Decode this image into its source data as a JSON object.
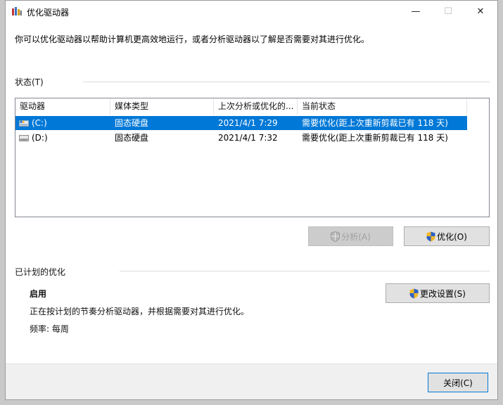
{
  "window": {
    "title": "优化驱动器",
    "controls": {
      "minimize": "—",
      "maximize": "☐",
      "close": "✕"
    }
  },
  "intro_text": "你可以优化驱动器以帮助计算机更高效地运行，或者分析驱动器以了解是否需要对其进行优化。",
  "status": {
    "label": "状态(T)",
    "columns": [
      "驱动器",
      "媒体类型",
      "上次分析或优化的...",
      "当前状态"
    ],
    "rows": [
      {
        "drive": "(C:)",
        "media": "固态硬盘",
        "last_run": "2021/4/1 7:29",
        "state": "需要优化(距上次重新剪裁已有 118 天)",
        "selected": true
      },
      {
        "drive": "(D:)",
        "media": "固态硬盘",
        "last_run": "2021/4/1 7:32",
        "state": "需要优化(距上次重新剪裁已有 118 天)",
        "selected": false
      }
    ],
    "buttons": {
      "analyze": "分析(A)",
      "optimize": "优化(O)"
    }
  },
  "scheduled": {
    "label": "已计划的优化",
    "state": "启用",
    "description": "正在按计划的节奏分析驱动器，并根据需要对其进行优化。",
    "frequency": "频率: 每周",
    "change_settings": "更改设置(S)"
  },
  "footer": {
    "close": "关闭(C)"
  },
  "colors": {
    "selection": "#0078d7",
    "button": "#e1e1e1",
    "footer": "#f0f0f0"
  }
}
